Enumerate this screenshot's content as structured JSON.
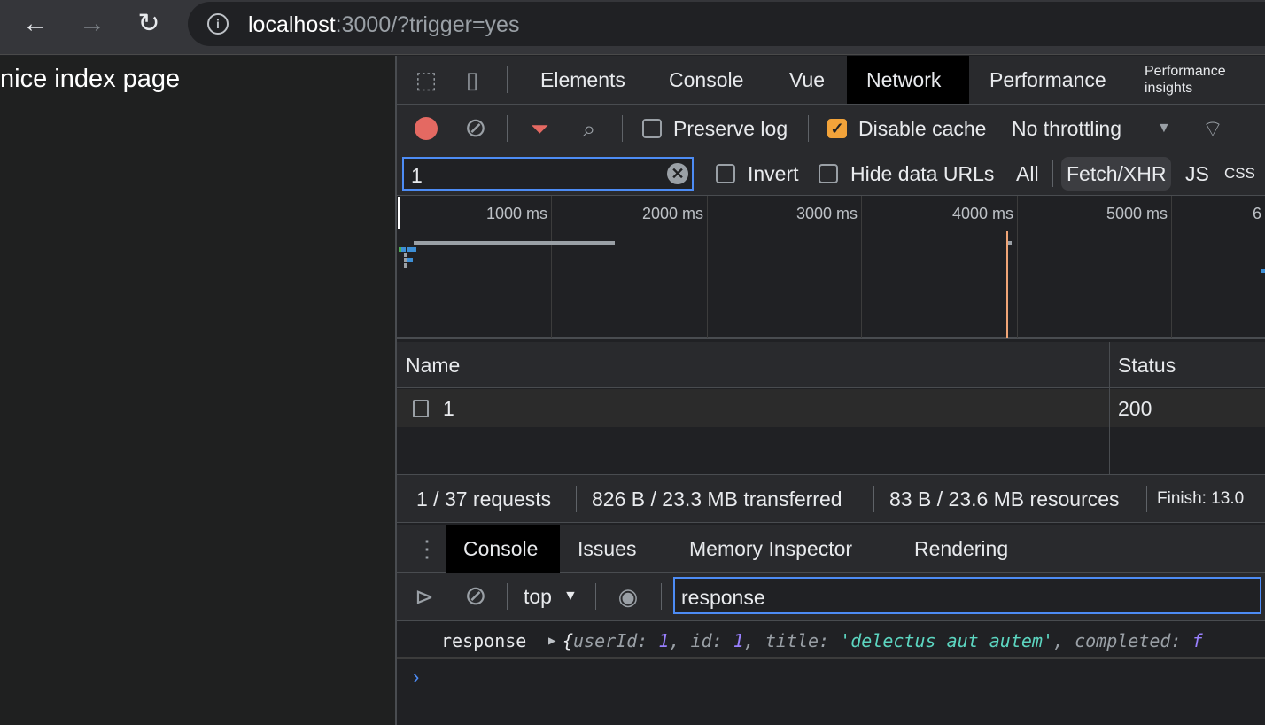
{
  "browser": {
    "url_host": "localhost",
    "url_rest": ":3000/?trigger=yes",
    "back": "←",
    "forward": "→",
    "reload": "↻"
  },
  "page": {
    "heading": "nice index page"
  },
  "devtools": {
    "tabs": [
      "Elements",
      "Console",
      "Vue",
      "Network",
      "Performance",
      "Performance insights"
    ],
    "selected_tab": "Network",
    "toolbar": {
      "preserve_log": "Preserve log",
      "preserve_log_checked": false,
      "disable_cache": "Disable cache",
      "disable_cache_checked": true,
      "throttling": "No throttling"
    },
    "filter": {
      "value": "1",
      "invert": "Invert",
      "hide_data_urls": "Hide data URLs",
      "types": [
        "All",
        "Fetch/XHR",
        "JS",
        "CSS"
      ],
      "selected_type": "Fetch/XHR"
    },
    "timeline": {
      "ticks": [
        "1000 ms",
        "2000 ms",
        "3000 ms",
        "4000 ms",
        "5000 ms",
        "6"
      ]
    },
    "table": {
      "columns": [
        "Name",
        "Status"
      ],
      "rows": [
        {
          "name": "1",
          "status": "200"
        }
      ]
    },
    "summary": [
      "1 / 37 requests",
      "826 B / 23.3 MB transferred",
      "83 B / 23.6 MB resources",
      "Finish: 13.0"
    ],
    "drawer": {
      "tabs": [
        "Console",
        "Issues",
        "Memory Inspector",
        "Rendering"
      ],
      "selected": "Console",
      "context": "top",
      "filter_value": "response"
    },
    "console": {
      "label": "response",
      "obj_open": "{",
      "k1": "userId",
      "v1": "1",
      "k2": "id",
      "v2": "1",
      "k3": "title",
      "v3": "'delectus aut autem'",
      "k4": "completed",
      "v4": "f"
    },
    "colors": {
      "record": "#e46962",
      "accent": "#f2a33a",
      "string": "#5cd5c0",
      "number": "#9980ff",
      "prompt": "#4d8cf5"
    }
  }
}
